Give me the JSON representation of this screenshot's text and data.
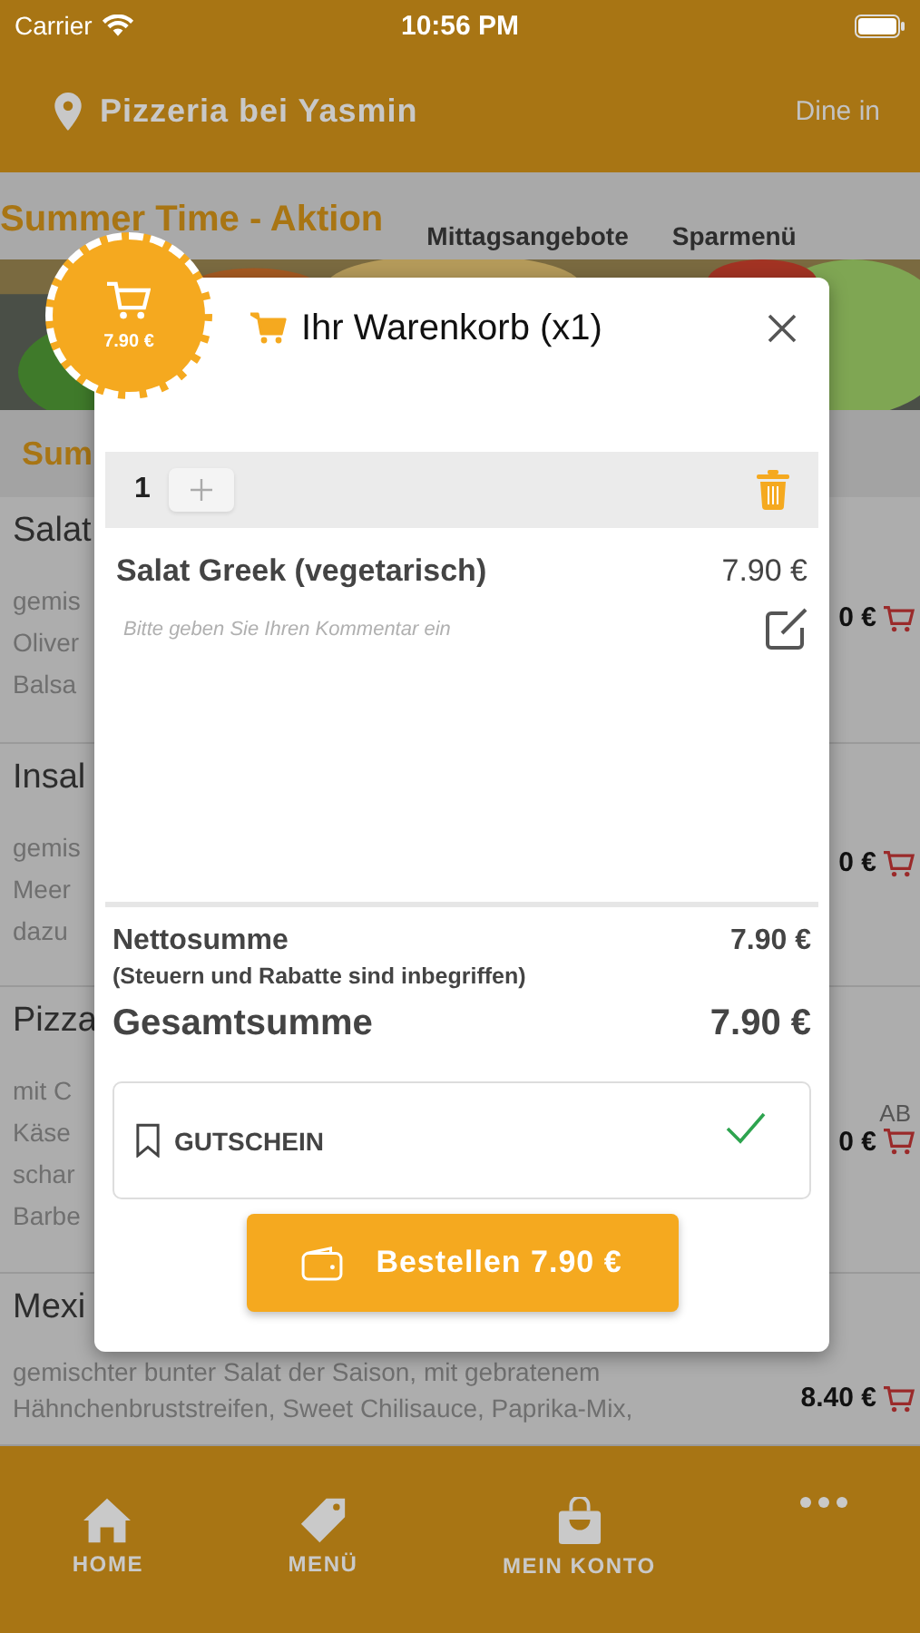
{
  "status_bar": {
    "carrier": "Carrier",
    "time": "10:56 PM"
  },
  "header": {
    "restaurant": "Pizzeria bei Yasmin",
    "mode": "Dine in"
  },
  "category_tabs": [
    {
      "label": "Summer Time - Aktion",
      "selected": true
    },
    {
      "label": "Mittagsangebote",
      "selected": false
    },
    {
      "label": "Sparmenü",
      "selected": false
    }
  ],
  "section_title": "Sum",
  "menu_items": [
    {
      "title": "Salat",
      "description": [
        "gemis",
        "Oliver",
        "Balsa"
      ],
      "price": "0 €"
    },
    {
      "title": "Insal",
      "description": [
        "gemis",
        "Meer",
        "dazu"
      ],
      "price": "0 €"
    },
    {
      "title": "Pizza",
      "description": [
        "mit C",
        "Käse",
        "schar",
        "Barbe"
      ],
      "price_prefix": "AB",
      "price": "0 €"
    },
    {
      "title": "Mexi",
      "description": [
        "gemischter bunter Salat der Saison, mit gebratenem",
        "Hähnchenbruststreifen, Sweet Chilisauce, Paprika-Mix,"
      ],
      "price": "8.40 €"
    }
  ],
  "cart_badge": {
    "total": "7.90 €"
  },
  "cart": {
    "title": "Ihr Warenkorb (x1)",
    "items": [
      {
        "quantity": "1",
        "name": "Salat Greek (vegetarisch)",
        "price": "7.90 €",
        "comment_placeholder": "Bitte geben Sie Ihren Kommentar ein"
      }
    ],
    "net_label": "Nettosumme",
    "net_value": "7.90 €",
    "net_note": "(Steuern und Rabatte sind inbegriffen)",
    "total_label": "Gesamtsumme",
    "total_value": "7.90 €",
    "coupon": {
      "label": "GUTSCHEIN",
      "applied": true
    },
    "order_button": "Bestellen 7.90 €"
  },
  "bottom_nav": [
    {
      "kind": "home",
      "label": "HOME"
    },
    {
      "kind": "tag",
      "label": "MENÜ"
    },
    {
      "kind": "bag",
      "label": "MEIN KONTO"
    },
    {
      "kind": "more"
    }
  ]
}
